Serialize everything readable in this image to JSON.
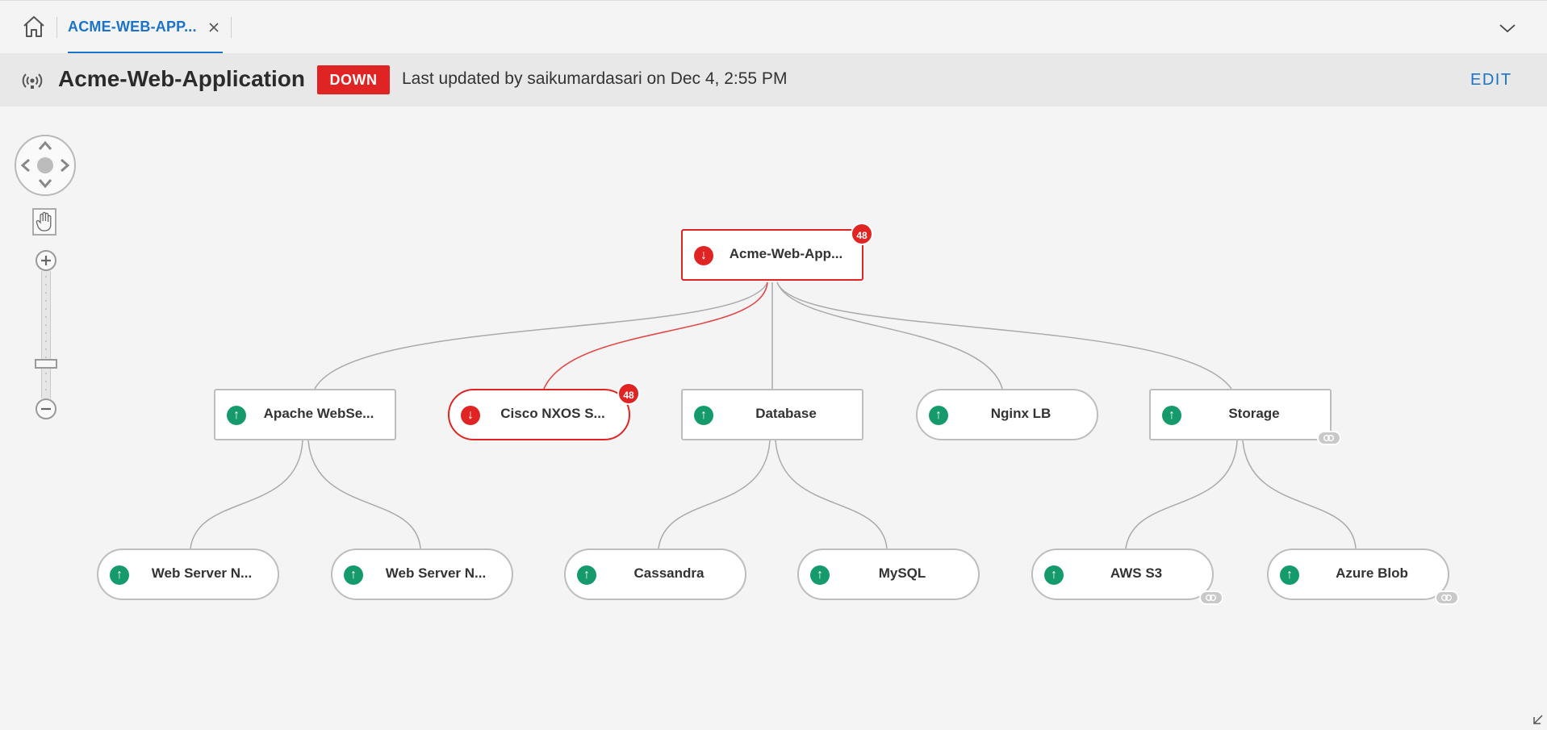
{
  "tabs": {
    "home_icon": "home-icon",
    "active_tab_label": "ACME-WEB-APP...",
    "close_icon": "close-icon",
    "expand_icon": "chevron-down-icon"
  },
  "header": {
    "icon": "service-broadcast-icon",
    "title": "Acme-Web-Application",
    "status": "DOWN",
    "last_updated": "Last updated by saikumardasari on Dec 4, 2:55 PM",
    "edit_label": "EDIT"
  },
  "colors": {
    "accent": "#1a73c9",
    "down": "#e02424",
    "up": "#159a6c",
    "edge": "#aaaaaa"
  },
  "topology": {
    "root": {
      "label": "Acme-Web-App...",
      "status": "down",
      "alerts": "48",
      "shape": "rect"
    },
    "tier1": [
      {
        "label": "Apache WebSe...",
        "status": "up",
        "shape": "rect"
      },
      {
        "label": "Cisco NXOS S...",
        "status": "down",
        "alerts": "48",
        "shape": "pill"
      },
      {
        "label": "Database",
        "status": "up",
        "shape": "rect"
      },
      {
        "label": "Nginx LB",
        "status": "up",
        "shape": "pill"
      },
      {
        "label": "Storage",
        "status": "up",
        "shape": "rect",
        "linked": true
      }
    ],
    "tier2": [
      {
        "label": "Web Server N...",
        "status": "up",
        "shape": "pill"
      },
      {
        "label": "Web Server N...",
        "status": "up",
        "shape": "pill"
      },
      {
        "label": "Cassandra",
        "status": "up",
        "shape": "pill"
      },
      {
        "label": "MySQL",
        "status": "up",
        "shape": "pill"
      },
      {
        "label": "AWS S3",
        "status": "up",
        "shape": "pill",
        "linked": true
      },
      {
        "label": "Azure Blob",
        "status": "up",
        "shape": "pill",
        "linked": true
      }
    ]
  }
}
